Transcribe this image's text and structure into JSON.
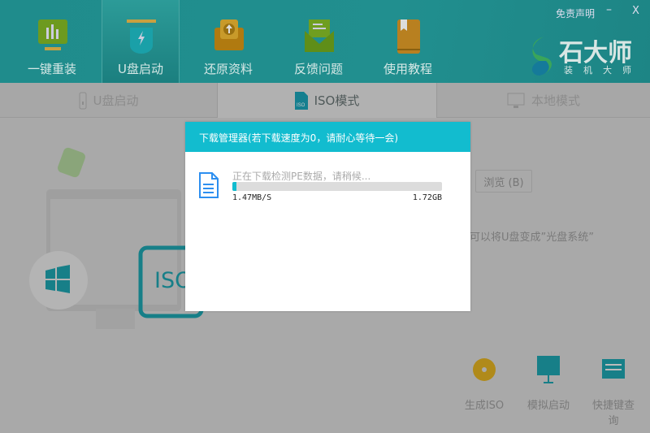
{
  "header": {
    "nav": [
      {
        "label": "一键重装",
        "icon": "monitor-chart-icon"
      },
      {
        "label": "U盘启动",
        "icon": "usb-drive-icon",
        "active": true
      },
      {
        "label": "还原资料",
        "icon": "restore-drive-icon"
      },
      {
        "label": "反馈问题",
        "icon": "envelope-icon"
      },
      {
        "label": "使用教程",
        "icon": "book-icon"
      }
    ],
    "disclaimer": "免责声明",
    "minimize": "–",
    "close": "X",
    "logo_title": "石大师",
    "logo_subtitle": "装机大师"
  },
  "tabs": [
    {
      "label": "U盘启动"
    },
    {
      "label": "ISO模式",
      "active": true
    },
    {
      "label": "本地模式"
    }
  ],
  "main": {
    "browse_button": "浏览 (B)",
    "hint_text": "可以将U盘变成”光盘系统”",
    "iso_label": "ISO",
    "tools": [
      {
        "label": "生成ISO",
        "icon": "disc-icon"
      },
      {
        "label": "模拟启动",
        "icon": "monitor-boot-icon"
      },
      {
        "label": "快捷键查询",
        "icon": "keyboard-icon"
      }
    ]
  },
  "dialog": {
    "title": "下载管理器(若下载速度为0，请耐心等待一会)",
    "message": "正在下载检测PE数据，请稍候...",
    "speed": "1.47MB/S",
    "size": "1.72GB",
    "progress_percent": 2,
    "accent": "#12bccf"
  }
}
